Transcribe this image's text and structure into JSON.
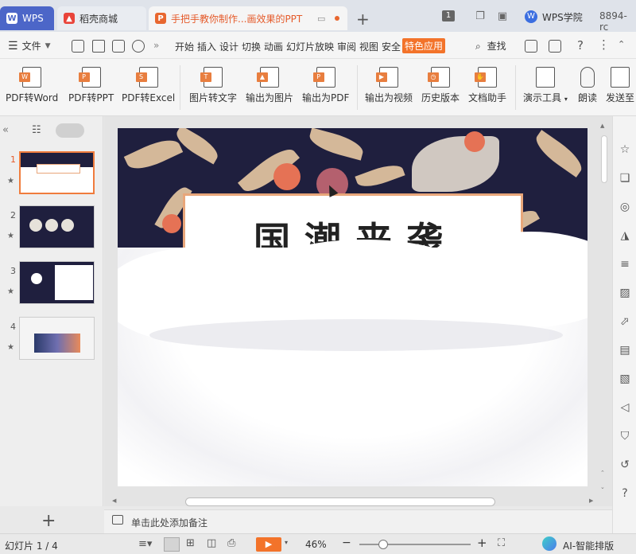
{
  "tabs": [
    {
      "label": "WPS"
    },
    {
      "label": "稻壳商城"
    },
    {
      "label": "手把手教你制作...画效果的PPT"
    }
  ],
  "titlebar": {
    "badge": "1",
    "academy": "WPS学院",
    "user": "8894-rc"
  },
  "menu": {
    "file": "文件",
    "tabs": [
      "开始",
      "插入",
      "设计",
      "切换",
      "动画",
      "幻灯片放映",
      "审阅",
      "视图",
      "安全",
      "特色应用"
    ],
    "search": "查找"
  },
  "ribbon": [
    {
      "label": "PDF转Word",
      "tag": "W"
    },
    {
      "label": "PDF转PPT",
      "tag": "P"
    },
    {
      "label": "PDF转Excel",
      "tag": "S"
    },
    {
      "label": "图片转文字",
      "tag": "T"
    },
    {
      "label": "输出为图片",
      "tag": ""
    },
    {
      "label": "输出为PDF",
      "tag": ""
    },
    {
      "label": "输出为视频",
      "tag": ""
    },
    {
      "label": "历史版本",
      "tag": ""
    },
    {
      "label": "文档助手",
      "tag": ""
    },
    {
      "label": "演示工具",
      "tag": ""
    },
    {
      "label": "朗读",
      "tag": ""
    },
    {
      "label": "发送至",
      "tag": ""
    }
  ],
  "slides": [
    {
      "num": "1"
    },
    {
      "num": "2"
    },
    {
      "num": "3"
    },
    {
      "num": "4"
    }
  ],
  "slide": {
    "title": "国潮来袭"
  },
  "notes": {
    "placeholder": "单击此处添加备注"
  },
  "status": {
    "count": "幻灯片 1 / 4",
    "zoom": "46%",
    "ai": "AI-智能排版"
  },
  "colors": {
    "accent": "#f3732a",
    "wps_blue": "#4c66c8",
    "slide_navy": "#1f1f3e",
    "leaf_gold": "#e8c9a3"
  }
}
